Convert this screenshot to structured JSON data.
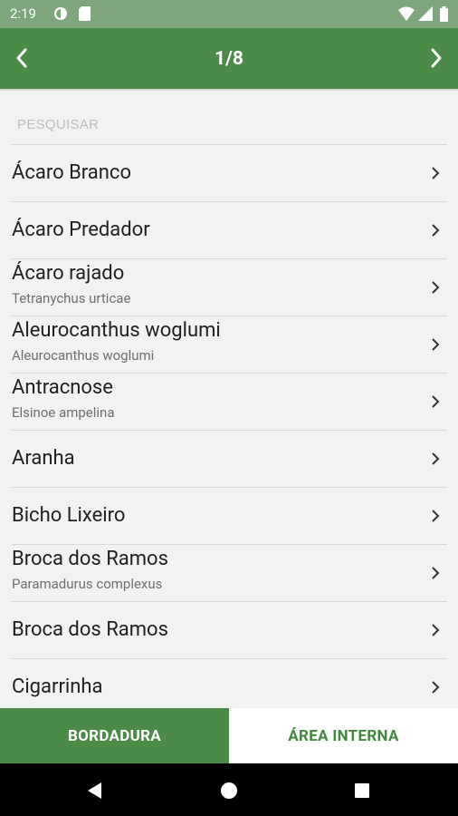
{
  "status_bar": {
    "time": "2:19"
  },
  "app_bar": {
    "title": "1/8"
  },
  "search": {
    "placeholder": "PESQUISAR"
  },
  "items": [
    {
      "title": "Ácaro Branco",
      "subtitle": ""
    },
    {
      "title": "Ácaro Predador",
      "subtitle": ""
    },
    {
      "title": "Ácaro rajado",
      "subtitle": "Tetranychus urticae"
    },
    {
      "title": "Aleurocanthus woglumi",
      "subtitle": "Aleurocanthus woglumi"
    },
    {
      "title": "Antracnose",
      "subtitle": "Elsinoe ampelina"
    },
    {
      "title": "Aranha",
      "subtitle": ""
    },
    {
      "title": "Bicho Lixeiro",
      "subtitle": ""
    },
    {
      "title": "Broca dos Ramos",
      "subtitle": "Paramadurus complexus"
    },
    {
      "title": "Broca dos Ramos",
      "subtitle": ""
    },
    {
      "title": "Cigarrinha",
      "subtitle": ""
    }
  ],
  "tabs": {
    "active": "BORDADURA",
    "inactive": "ÁREA INTERNA"
  },
  "colors": {
    "primary": "#4c8a48",
    "status_bar": "#7fa57c",
    "background": "#f1f3f0"
  }
}
